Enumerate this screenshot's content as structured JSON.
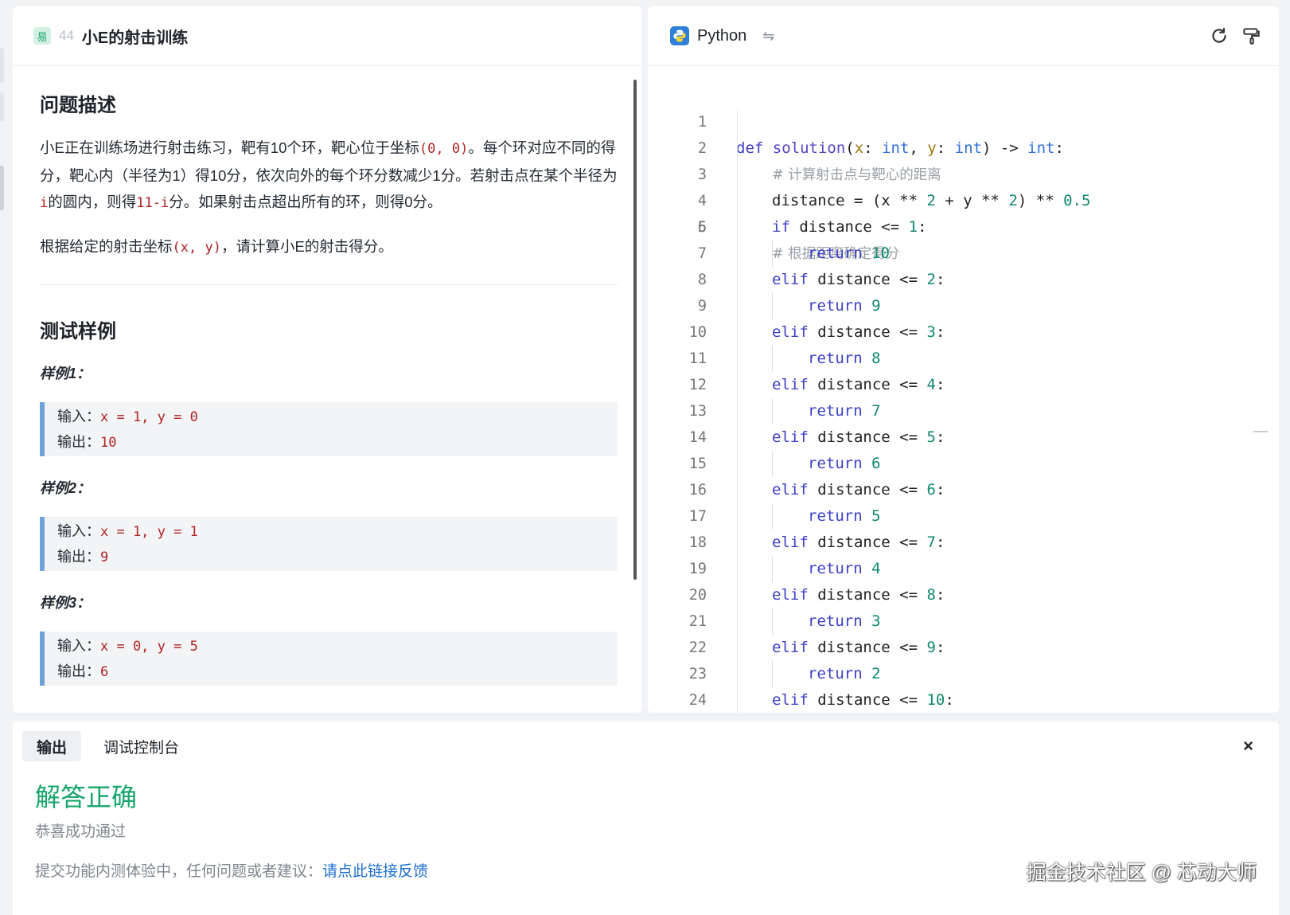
{
  "problem": {
    "difficulty_badge": "易",
    "number": "44",
    "title": "小E的射击训练",
    "desc_heading": "问题描述",
    "desc_p1_a": "小E正在训练场进行射击练习，靶有10个环，靶心位于坐标",
    "desc_p1_code1": "(0, 0)",
    "desc_p1_b": "。每个环对应不同的得分，靶心内（半径为1）得10分，依次向外的每个环分数减少1分。若射击点在某个半径为",
    "desc_p1_code2": "i",
    "desc_p1_c": "的圆内，则得",
    "desc_p1_code3": "11-i",
    "desc_p1_d": "分。如果射击点超出所有的环，则得0分。",
    "desc_p2_a": "根据给定的射击坐标",
    "desc_p2_code": "(x, y)",
    "desc_p2_b": "，请计算小E的射击得分。",
    "examples_heading": "测试样例",
    "examples": [
      {
        "label": "样例1：",
        "input_label": "输入：",
        "input": "x = 1, y = 0",
        "output_label": "输出：",
        "output": "10"
      },
      {
        "label": "样例2：",
        "input_label": "输入：",
        "input": "x = 1, y = 1",
        "output_label": "输出：",
        "output": "9"
      },
      {
        "label": "样例3：",
        "input_label": "输入：",
        "input": "x = 0, y = 5",
        "output_label": "输出：",
        "output": "6"
      }
    ]
  },
  "editor": {
    "language": "Python",
    "swap_icon": "swap-icon",
    "reset_icon": "refresh-icon",
    "format_icon": "paint-roller-icon",
    "line_numbers": [
      "1",
      "2",
      "3",
      "4",
      "5",
      "6",
      "7",
      "8",
      "9",
      "10",
      "11",
      "12",
      "13",
      "14",
      "15",
      "16",
      "17",
      "18",
      "19",
      "20",
      "21",
      "22",
      "23",
      "24"
    ],
    "code": {
      "l1": {
        "def": "def ",
        "name": "solution",
        "open": "(",
        "x": "x",
        "c1": ": ",
        "int1": "int",
        "comma": ", ",
        "y": "y",
        "c2": ": ",
        "int2": "int",
        "close": ") -> ",
        "int3": "int",
        "colon": ":"
      },
      "l2": "# 计算射击点与靶心的距离",
      "l3": {
        "a": "distance = (x ** ",
        "n1": "2",
        "b": " + y ** ",
        "n2": "2",
        "c": ") ** ",
        "n3": "0.5"
      },
      "l5": "# 根据距离确定得分",
      "branches": [
        {
          "kw": "if",
          "cond": " distance <= ",
          "n": "1",
          "ret": "return",
          "rv": "10"
        },
        {
          "kw": "elif",
          "cond": " distance <= ",
          "n": "2",
          "ret": "return",
          "rv": "9"
        },
        {
          "kw": "elif",
          "cond": " distance <= ",
          "n": "3",
          "ret": "return",
          "rv": "8"
        },
        {
          "kw": "elif",
          "cond": " distance <= ",
          "n": "4",
          "ret": "return",
          "rv": "7"
        },
        {
          "kw": "elif",
          "cond": " distance <= ",
          "n": "5",
          "ret": "return",
          "rv": "6"
        },
        {
          "kw": "elif",
          "cond": " distance <= ",
          "n": "6",
          "ret": "return",
          "rv": "5"
        },
        {
          "kw": "elif",
          "cond": " distance <= ",
          "n": "7",
          "ret": "return",
          "rv": "4"
        },
        {
          "kw": "elif",
          "cond": " distance <= ",
          "n": "8",
          "ret": "return",
          "rv": "3"
        },
        {
          "kw": "elif",
          "cond": " distance <= ",
          "n": "9",
          "ret": "return",
          "rv": "2"
        },
        {
          "kw": "elif",
          "cond": " distance <= ",
          "n": "10",
          "ret": "",
          "rv": ""
        }
      ]
    }
  },
  "output": {
    "tabs": [
      "输出",
      "调试控制台"
    ],
    "close": "×",
    "result_title": "解答正确",
    "result_sub": "恭喜成功通过",
    "feedback_text": "提交功能内测体验中，任何问题或者建议：",
    "feedback_link": "请点此链接反馈"
  },
  "watermark": "掘金技术社区 @ 芯动大师",
  "colors": {
    "accent_green": "#16a56a",
    "link_blue": "#1e6fd1",
    "example_bar": "#6fa3d8",
    "code_red": "#b32222"
  }
}
